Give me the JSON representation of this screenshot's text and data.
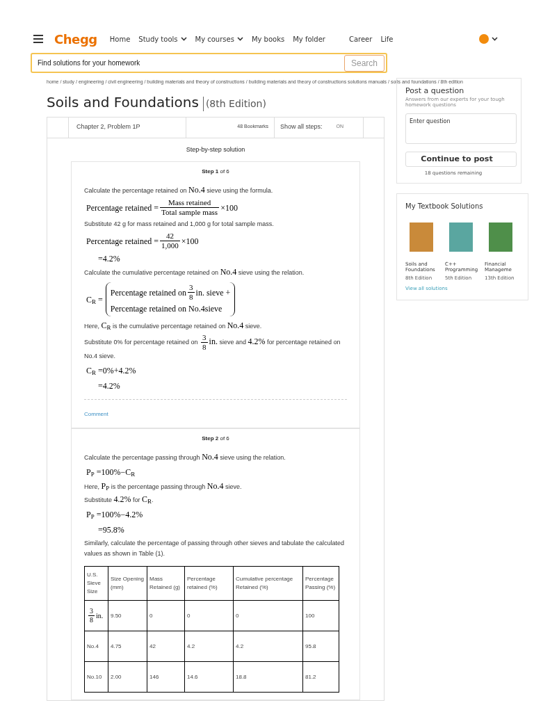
{
  "nav": {
    "logo": "Chegg",
    "links": [
      {
        "label": "Home",
        "dropdown": false
      },
      {
        "label": "Study tools",
        "dropdown": true
      },
      {
        "label": "My courses",
        "dropdown": true
      },
      {
        "label": "My books",
        "dropdown": false
      },
      {
        "label": "My folder",
        "dropdown": false
      },
      {
        "label": "Career",
        "dropdown": false
      },
      {
        "label": "Life",
        "dropdown": false
      }
    ]
  },
  "search": {
    "placeholder": "Find solutions for your homework",
    "button": "Search"
  },
  "breadcrumb": "home / study / engineering / civil engineering / building materials and theory of constructions / building materials and theory of constructions solutions manuals / soils and foundations / 8th edition",
  "book": {
    "title": "Soils and Foundations",
    "edition": "(8th Edition)"
  },
  "problem": {
    "chapter": "Chapter 2, Problem 1P",
    "bookmarks": "48 Bookmarks",
    "show_steps_label": "Show all steps:",
    "show_steps_toggle": {
      "label": "ON",
      "on": true
    }
  },
  "solution_heading": "Step-by-step solution",
  "steps": [
    {
      "title": "**Step 1** of 6",
      "blocks": [
        {
          "kind": "para",
          "parts": [
            {
              "kind": "text",
              "text": "Calculate the percentage retained on "
            },
            {
              "kind": "math",
              "text": "No.4"
            },
            {
              "kind": "text",
              "text": " sieve using the formula."
            }
          ]
        },
        {
          "kind": "eq",
          "parts": [
            {
              "kind": "math",
              "text": "Percentage retained ="
            },
            {
              "kind": "frac",
              "num": "Mass retained",
              "den": "Total sample mass"
            },
            {
              "kind": "math",
              "text": "×100"
            }
          ]
        },
        {
          "kind": "para",
          "parts": [
            {
              "kind": "text",
              "text": "Substitute 42 g for mass retained and 1,000 g for total sample mass."
            }
          ]
        },
        {
          "kind": "eq",
          "parts": [
            {
              "kind": "math",
              "text": "Percentage retained ="
            },
            {
              "kind": "frac",
              "num": "42",
              "den": "1,000"
            },
            {
              "kind": "math",
              "text": "×100"
            }
          ]
        },
        {
          "kind": "cont",
          "parts": [
            {
              "kind": "math",
              "text": "=4.2%"
            }
          ]
        },
        {
          "kind": "para",
          "parts": [
            {
              "kind": "text",
              "text": "Calculate the cumulative percentage retained on "
            },
            {
              "kind": "math",
              "text": "No.4"
            },
            {
              "kind": "text",
              "text": " sieve using the relation."
            }
          ]
        },
        {
          "kind": "bracket",
          "lhs": "C$_{R}$ =",
          "rows": [
            [
              {
                "kind": "math",
                "text": "Percentage retained on "
              },
              {
                "kind": "frac",
                "num": "3",
                "den": "8"
              },
              {
                "kind": "math",
                "text": "in. sieve +"
              }
            ],
            [
              {
                "kind": "math",
                "text": "Percentage retained on No.4sieve"
              }
            ]
          ]
        },
        {
          "kind": "para",
          "parts": [
            {
              "kind": "text",
              "text": "Here, "
            },
            {
              "kind": "math",
              "text": "C$_{R}$"
            },
            {
              "kind": "text",
              "text": " is the cumulative percentage retained on "
            },
            {
              "kind": "math",
              "text": "No.4"
            },
            {
              "kind": "text",
              "text": " sieve."
            }
          ]
        },
        {
          "kind": "para",
          "parts": [
            {
              "kind": "text",
              "text": "Substitute 0% for percentage retained on "
            },
            {
              "kind": "frac",
              "num": "3",
              "den": "8"
            },
            {
              "kind": "math",
              "text": "in."
            },
            {
              "kind": "text",
              "text": " sieve and "
            },
            {
              "kind": "math",
              "text": "4.2%"
            },
            {
              "kind": "text",
              "text": " for percentage retained on No.4 sieve."
            }
          ]
        },
        {
          "kind": "eq",
          "parts": [
            {
              "kind": "math",
              "text": "C$_{R}$ =0%+4.2%"
            }
          ]
        },
        {
          "kind": "cont",
          "parts": [
            {
              "kind": "math",
              "text": "=4.2%"
            }
          ]
        }
      ],
      "comment": "Comment"
    },
    {
      "title": "**Step 2** of 6",
      "blocks": [
        {
          "kind": "para",
          "parts": [
            {
              "kind": "text",
              "text": "Calculate the percentage passing through "
            },
            {
              "kind": "math",
              "text": "No.4"
            },
            {
              "kind": "text",
              "text": " sieve using the relation."
            }
          ]
        },
        {
          "kind": "eq",
          "parts": [
            {
              "kind": "math",
              "text": "P$_{P}$ =100%−C$_{R}$"
            }
          ]
        },
        {
          "kind": "para",
          "parts": [
            {
              "kind": "text",
              "text": "Here, "
            },
            {
              "kind": "math",
              "text": "P$_{P}$"
            },
            {
              "kind": "text",
              "text": " is the percentage passing through "
            },
            {
              "kind": "math",
              "text": "No.4"
            },
            {
              "kind": "text",
              "text": " sieve."
            }
          ]
        },
        {
          "kind": "para",
          "parts": [
            {
              "kind": "text",
              "text": "Substitute "
            },
            {
              "kind": "math",
              "text": "4.2%"
            },
            {
              "kind": "text",
              "text": " for "
            },
            {
              "kind": "math",
              "text": "C$_{R}$"
            },
            {
              "kind": "text",
              "text": "."
            }
          ]
        },
        {
          "kind": "eq",
          "parts": [
            {
              "kind": "math",
              "text": "P$_{P}$ =100%−4.2%"
            }
          ]
        },
        {
          "kind": "cont",
          "parts": [
            {
              "kind": "math",
              "text": "=95.8%"
            }
          ]
        },
        {
          "kind": "para",
          "parts": [
            {
              "kind": "text",
              "text": "Similarly, calculate the percentage of passing through other sieves and tabulate the calculated values as shown in Table (1)."
            }
          ]
        }
      ],
      "table": {
        "columns": [
          "U.S. Sieve Size",
          "Size Opening (mm)",
          "Mass Retained (g)",
          "Percentage retained (%)",
          "Cumulative percentage Retained (%)",
          "Percentage Passing (%)"
        ],
        "rows": [
          [
            {
              "kind": "frac",
              "num": "3",
              "den": "8",
              "after": "in."
            },
            "9.50",
            "0",
            "0",
            "0",
            "100"
          ],
          [
            "No.4",
            "4.75",
            "42",
            "4.2",
            "4.2",
            "95.8"
          ],
          [
            "No.10",
            "2.00",
            "146",
            "14.6",
            "18.8",
            "81.2"
          ]
        ]
      }
    }
  ],
  "sidebar": {
    "post": {
      "title": "Post a question",
      "subtitle": "Answers from our experts for your tough homework questions",
      "input_placeholder": "Enter question",
      "button": "Continue to post",
      "remaining": "18 questions remaining"
    },
    "textbooks": {
      "title": "My Textbook Solutions",
      "books": [
        {
          "title": "Soils and Foundations",
          "edition": "8th Edition",
          "color": "#c98a3a"
        },
        {
          "title": "C++ Programming",
          "edition": "5th Edition",
          "color": "#5aa6a0"
        },
        {
          "title": "Financial Manageme",
          "edition": "13th Edition",
          "color": "#4f8f4a"
        }
      ],
      "link": "View all solutions"
    }
  }
}
